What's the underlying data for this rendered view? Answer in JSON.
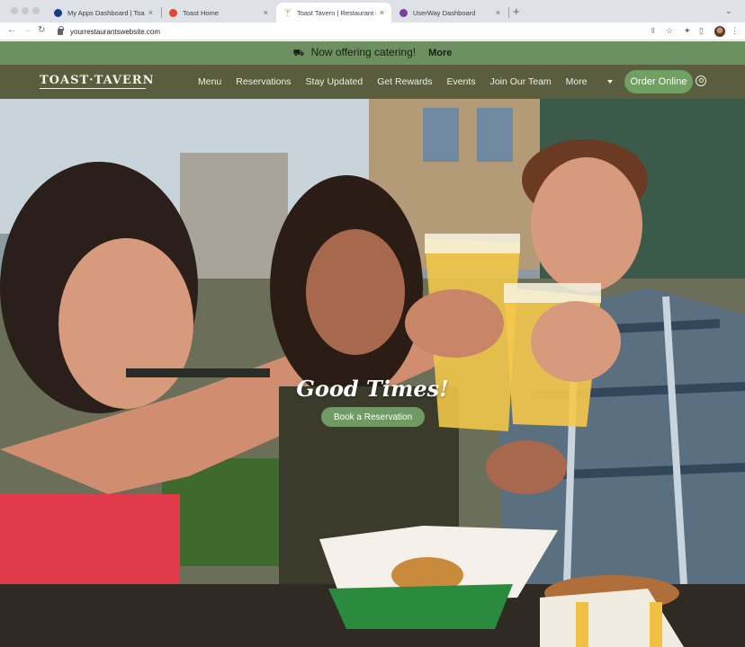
{
  "browser": {
    "tabs": [
      {
        "title": "My Apps Dashboard | Toast, I",
        "favicon_color": "#1a3a8c"
      },
      {
        "title": "Toast Home",
        "favicon_color": "#e8442e"
      },
      {
        "title": "Toast Tavern | Restaurant in E",
        "favicon_color": "#3a3a3a"
      },
      {
        "title": "UserWay Dashboard",
        "favicon_color": "#7b3fa0"
      }
    ],
    "url": "yourrestaurantswebsite.com"
  },
  "promo": {
    "text": "Now offering catering!",
    "link": "More"
  },
  "site": {
    "logo": "TOAST·TAVERN",
    "nav": [
      "Menu",
      "Reservations",
      "Stay Updated",
      "Get Rewards",
      "Events",
      "Join Our Team"
    ],
    "more": "More",
    "order_button": "Order Online"
  },
  "hero": {
    "title": "Good Times!",
    "button": "Book a Reservation"
  },
  "colors": {
    "promo_bg": "#6c9060",
    "nav_bg": "#5a5e3f",
    "accent_green": "#71a063"
  }
}
